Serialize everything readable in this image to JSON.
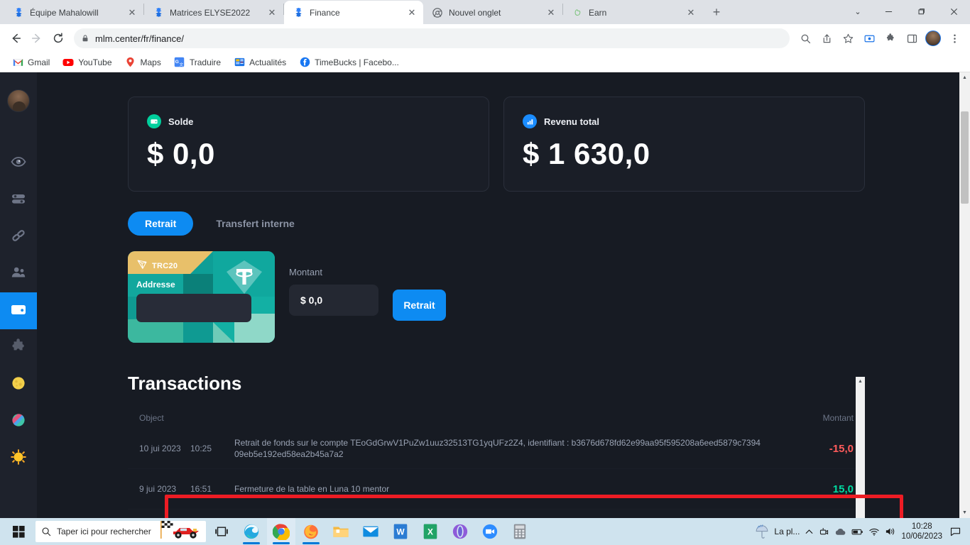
{
  "browser": {
    "tabs": [
      {
        "title": "Équipe Mahalowill",
        "favicon": "firefox-tab-icon",
        "active": false
      },
      {
        "title": "Matrices ELYSE2022",
        "favicon": "firefox-tab-icon",
        "active": false
      },
      {
        "title": "Finance",
        "favicon": "firefox-tab-icon",
        "active": true
      },
      {
        "title": "Nouvel onglet",
        "favicon": "chrome-icon",
        "active": false
      },
      {
        "title": "Earn",
        "favicon": "earn-icon",
        "active": false
      }
    ],
    "new_tab_label": "+",
    "close_label": "✕",
    "window_controls": {
      "chevron": "⌄",
      "minimize": "–",
      "maximize": "❐",
      "close": "✕"
    },
    "url": "mlm.center/fr/finance/",
    "bookmarks": [
      {
        "label": "Gmail",
        "icon": "gmail-icon"
      },
      {
        "label": "YouTube",
        "icon": "youtube-icon"
      },
      {
        "label": "Maps",
        "icon": "maps-icon"
      },
      {
        "label": "Traduire",
        "icon": "translate-icon"
      },
      {
        "label": "Actualités",
        "icon": "news-icon"
      },
      {
        "label": "TimeBucks | Facebo...",
        "icon": "facebook-icon"
      }
    ]
  },
  "sidebar": {
    "items": [
      {
        "name": "avatar",
        "icon": "user-avatar"
      },
      {
        "name": "eye",
        "icon": "eye-icon"
      },
      {
        "name": "toggles",
        "icon": "sliders-icon"
      },
      {
        "name": "link",
        "icon": "chain-link-icon"
      },
      {
        "name": "team",
        "icon": "users-icon"
      },
      {
        "name": "finance",
        "icon": "wallet-icon",
        "active": true
      },
      {
        "name": "puzzle",
        "icon": "puzzle-icon"
      },
      {
        "name": "moon",
        "icon": "moon-icon"
      },
      {
        "name": "planet",
        "icon": "planet-icon"
      },
      {
        "name": "sun",
        "icon": "sun-icon"
      }
    ]
  },
  "main": {
    "cards": [
      {
        "label": "Solde",
        "value": "$ 0,0",
        "icon": "wallet-icon",
        "color": "#00cf9d"
      },
      {
        "label": "Revenu total",
        "value": "$ 1 630,0",
        "icon": "bar-chart-icon",
        "color": "#1a8cff"
      }
    ],
    "tabs": [
      {
        "label": "Retrait",
        "active": true
      },
      {
        "label": "Transfert interne",
        "active": false
      }
    ],
    "withdraw_form": {
      "network_label": "TRC20",
      "address_label": "Addresse",
      "address_value": "",
      "amount_label": "Montant",
      "amount_value": "$ 0,0",
      "submit_label": "Retrait"
    },
    "transactions": {
      "title": "Transactions",
      "columns": {
        "object": "Object",
        "amount": "Montant"
      },
      "rows": [
        {
          "date": "10 jui 2023",
          "time": "10:25",
          "description": "Retrait de fonds sur le compte TEoGdGrwV1PuZw1uuz32513TG1yqUFz2Z4, identifiant : b3676d678fd62e99aa95f595208a6eed5879c739409eb5e192ed58ea2b45a7a2",
          "amount": "-15,0",
          "sign": "neg",
          "highlighted": true
        },
        {
          "date": "9 jui 2023",
          "time": "16:51",
          "description": "Fermeture de la table en Luna 10 mentor",
          "amount": "15,0",
          "sign": "pos",
          "highlighted": false
        }
      ]
    }
  },
  "taskbar": {
    "search_placeholder": "Taper ici pour rechercher",
    "apps": [
      {
        "name": "task-view",
        "icon": "task-view-icon"
      },
      {
        "name": "edge",
        "icon": "edge-icon"
      },
      {
        "name": "chrome",
        "icon": "chrome-icon"
      },
      {
        "name": "firefox",
        "icon": "firefox-icon"
      },
      {
        "name": "file-explorer",
        "icon": "folder-icon"
      },
      {
        "name": "mail",
        "icon": "mail-icon"
      },
      {
        "name": "word",
        "icon": "word-icon"
      },
      {
        "name": "excel",
        "icon": "excel-icon"
      },
      {
        "name": "opera",
        "icon": "opera-icon"
      },
      {
        "name": "zoom",
        "icon": "zoom-icon"
      },
      {
        "name": "calculator",
        "icon": "calculator-icon"
      }
    ],
    "weather": "La pl...",
    "time": "10:28",
    "date": "10/06/2023"
  },
  "colors": {
    "accent": "#0d8bf2",
    "positive": "#00dba0",
    "negative": "#ff5b5b",
    "annotation": "#ed1c24",
    "bg_dark": "#171b23",
    "card_bg": "#1a1e27"
  }
}
